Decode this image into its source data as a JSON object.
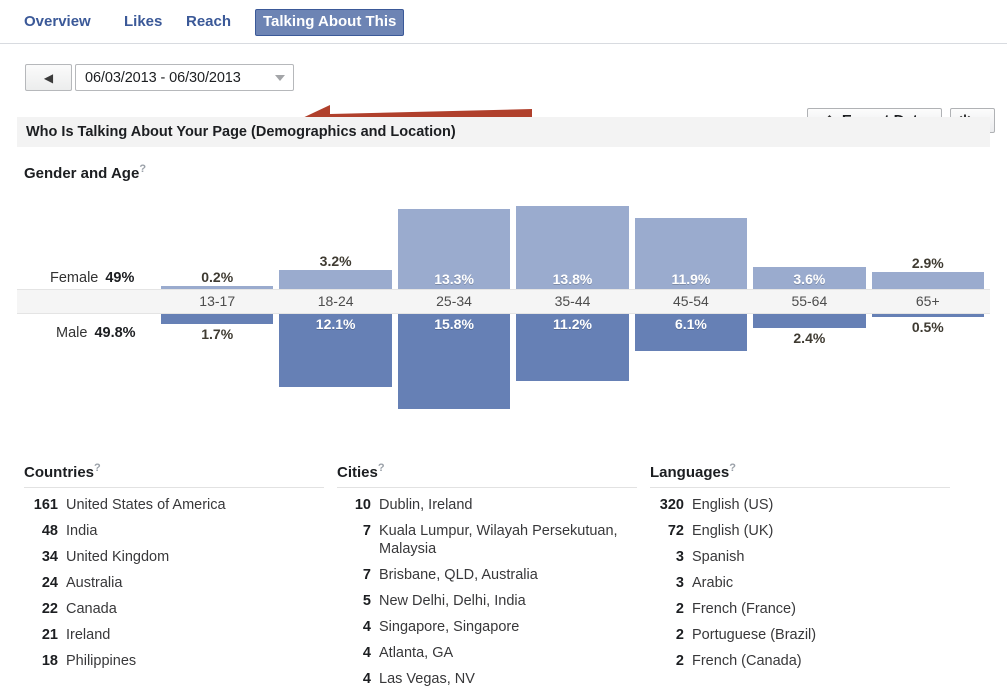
{
  "tabs": [
    {
      "label": "Overview",
      "active": false
    },
    {
      "label": "Likes",
      "active": false
    },
    {
      "label": "Reach",
      "active": false
    },
    {
      "label": "Talking About This",
      "active": true
    }
  ],
  "toolbar": {
    "prev_glyph": "◀",
    "date_range": "06/03/2013 - 06/30/2013",
    "caret_icon": "chevron-down-icon",
    "export_label": "Export Data",
    "export_icon": "upload-icon",
    "gear_icon": "gear-icon",
    "gear_glyph": "⚙"
  },
  "section": {
    "header": "Who Is Talking About Your Page (Demographics and Location)"
  },
  "gender_age": {
    "title": "Gender and Age",
    "help": "?",
    "female_label": "Female",
    "female_total": "49%",
    "male_label": "Male",
    "male_total": "49.8%"
  },
  "chart_data": {
    "type": "bar",
    "title": "Gender and Age",
    "categories": [
      "13-17",
      "18-24",
      "25-34",
      "35-44",
      "45-54",
      "55-64",
      "65+"
    ],
    "series": [
      {
        "name": "Female",
        "total": 49.0,
        "values": [
          0.2,
          3.2,
          13.3,
          13.8,
          11.9,
          3.6,
          2.9
        ],
        "labels": [
          "0.2%",
          "3.2%",
          "13.3%",
          "13.8%",
          "11.9%",
          "3.6%",
          "2.9%"
        ],
        "color": "#9aabce",
        "direction": "up"
      },
      {
        "name": "Male",
        "total": 49.8,
        "values": [
          1.7,
          12.1,
          15.8,
          11.2,
          6.1,
          2.4,
          0.5
        ],
        "labels": [
          "1.7%",
          "12.1%",
          "15.8%",
          "11.2%",
          "6.1%",
          "2.4%",
          "0.5%"
        ],
        "color": "#6680b5",
        "direction": "down"
      }
    ],
    "xlabel": "",
    "ylabel": "",
    "ylim": [
      0,
      16
    ],
    "grid": false,
    "legend": "inline-left"
  },
  "countries": {
    "title": "Countries",
    "help": "?",
    "rows": [
      {
        "count": "161",
        "name": "United States of America"
      },
      {
        "count": "48",
        "name": "India"
      },
      {
        "count": "34",
        "name": "United Kingdom"
      },
      {
        "count": "24",
        "name": "Australia"
      },
      {
        "count": "22",
        "name": "Canada"
      },
      {
        "count": "21",
        "name": "Ireland"
      },
      {
        "count": "18",
        "name": "Philippines"
      }
    ]
  },
  "cities": {
    "title": "Cities",
    "help": "?",
    "rows": [
      {
        "count": "10",
        "name": "Dublin, Ireland"
      },
      {
        "count": "7",
        "name": "Kuala Lumpur, Wilayah Persekutuan, Malaysia"
      },
      {
        "count": "7",
        "name": "Brisbane, QLD, Australia"
      },
      {
        "count": "5",
        "name": "New Delhi, Delhi, India"
      },
      {
        "count": "4",
        "name": "Singapore, Singapore"
      },
      {
        "count": "4",
        "name": "Atlanta, GA"
      },
      {
        "count": "4",
        "name": "Las Vegas, NV"
      }
    ]
  },
  "languages": {
    "title": "Languages",
    "help": "?",
    "rows": [
      {
        "count": "320",
        "name": "English (US)"
      },
      {
        "count": "72",
        "name": "English (UK)"
      },
      {
        "count": "3",
        "name": "Spanish"
      },
      {
        "count": "3",
        "name": "Arabic"
      },
      {
        "count": "2",
        "name": "French (France)"
      },
      {
        "count": "2",
        "name": "Portuguese (Brazil)"
      },
      {
        "count": "2",
        "name": "French (Canada)"
      }
    ]
  },
  "annotation": {
    "arrow_color": "#b0402c",
    "arrow_direction": "left"
  }
}
